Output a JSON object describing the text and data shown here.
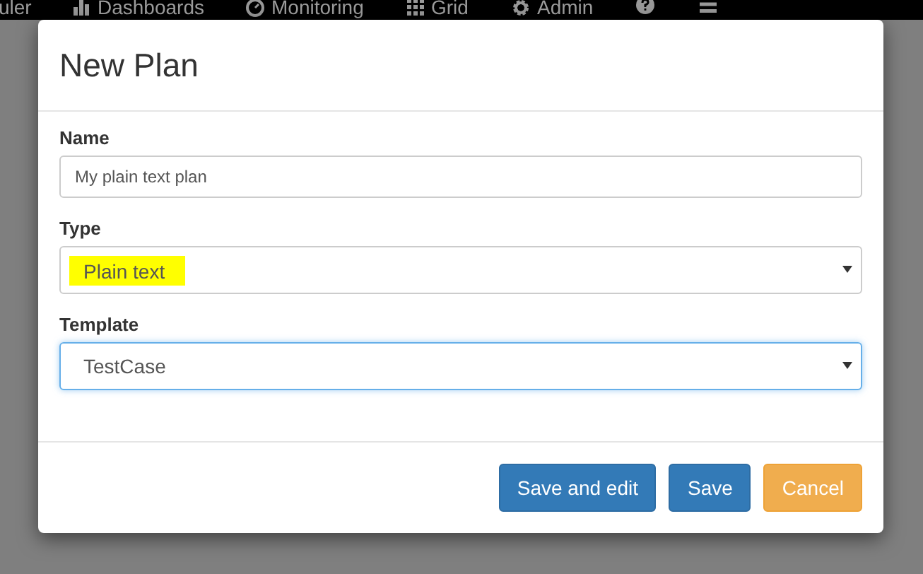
{
  "navbar": {
    "items": [
      {
        "label": "uler",
        "kind": "plain"
      },
      {
        "label": "Dashboards",
        "kind": "bars"
      },
      {
        "label": "Monitoring",
        "kind": "gauge"
      },
      {
        "label": "Grid",
        "kind": "grid"
      },
      {
        "label": "Admin",
        "kind": "gear"
      },
      {
        "kind": "question"
      },
      {
        "kind": "menu"
      }
    ]
  },
  "dialog": {
    "title": "New Plan",
    "fields": [
      {
        "kind": "text",
        "label": "Name",
        "value": "My plain text plan",
        "highlighted": false,
        "focused": false
      },
      {
        "kind": "select",
        "label": "Type",
        "value": "Plain text",
        "highlighted": true,
        "focused": false
      },
      {
        "kind": "select",
        "label": "Template",
        "value": "TestCase",
        "highlighted": false,
        "focused": true
      }
    ],
    "buttons": [
      {
        "label": "Save and edit",
        "kind": "primary"
      },
      {
        "label": "Save",
        "kind": "primary"
      },
      {
        "label": "Cancel",
        "kind": "warning"
      }
    ]
  }
}
